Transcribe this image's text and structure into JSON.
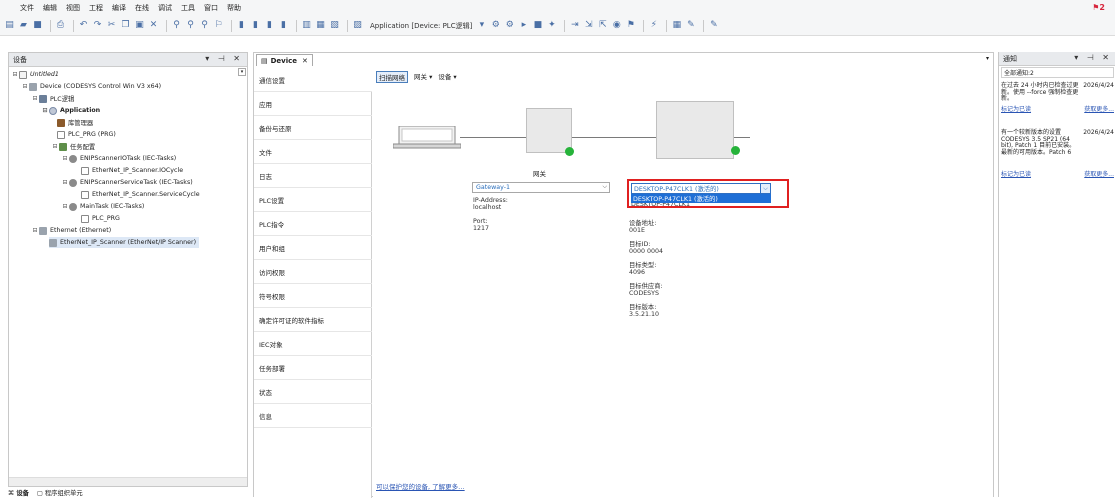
{
  "menu": [
    "文件",
    "编辑",
    "视图",
    "工程",
    "编译",
    "在线",
    "调试",
    "工具",
    "窗口",
    "帮助"
  ],
  "notification_count": "2",
  "toolbar": {
    "application_label": "Application [Device: PLC逻辑]"
  },
  "devices_pane": {
    "title": "设备",
    "controls": "▾ ⊣ ✕",
    "tree": [
      {
        "label": "Untitled1"
      },
      {
        "label": "Device (CODESYS Control Win V3 x64)"
      },
      {
        "label": "PLC逻辑"
      },
      {
        "label": "Application"
      },
      {
        "label": "库管理器"
      },
      {
        "label": "PLC_PRG (PRG)"
      },
      {
        "label": "任务配置"
      },
      {
        "label": "ENIPScannerIOTask (IEC-Tasks)"
      },
      {
        "label": "EtherNet_IP_Scanner.IOCycle"
      },
      {
        "label": "ENIPScannerServiceTask (IEC-Tasks)"
      },
      {
        "label": "EtherNet_IP_Scanner.ServiceCycle"
      },
      {
        "label": "MainTask (IEC-Tasks)"
      },
      {
        "label": "PLC_PRG"
      },
      {
        "label": "Ethernet (Ethernet)"
      },
      {
        "label": "EtherNet_IP_Scanner (EtherNet/IP Scanner)"
      }
    ]
  },
  "bottom_tabs": [
    "设备",
    "程序组织单元"
  ],
  "editor": {
    "tab_label": "Device",
    "nav": [
      "通信设置",
      "应用",
      "备份与还原",
      "文件",
      "日志",
      "PLC设置",
      "PLC指令",
      "用户和组",
      "访问权限",
      "符号权限",
      "确定许可证的软件指标",
      "IEC对象",
      "任务部署",
      "状态",
      "信息"
    ],
    "scan_tabs": [
      "扫描网络",
      "网关 ▾",
      "设备 ▾"
    ],
    "gateway": {
      "label": "网关",
      "selected": "Gateway-1",
      "ip_label": "IP-Address:",
      "ip_value": "localhost",
      "port_label": "Port:",
      "port_value": "1217"
    },
    "device": {
      "selected": "DESKTOP-P47CLK1 (激活的)",
      "option": "DESKTOP-P47CLK1 (激活的)",
      "name_partial": "DESKTOP-P47CLK1",
      "fields": [
        {
          "label": "设备地址:",
          "value": "001E"
        },
        {
          "label": "目标ID:",
          "value": "0000 0004"
        },
        {
          "label": "目标类型:",
          "value": "4096"
        },
        {
          "label": "目标供应商:",
          "value": "CODESYS"
        },
        {
          "label": "目标版本:",
          "value": "3.5.21.10"
        }
      ]
    },
    "bottom_link": "可以保护您的设备, 了解更多…"
  },
  "notifications_pane": {
    "title": "通知",
    "controls": "▾ ⊣ ✕",
    "all_label": "全部通知:2",
    "items": [
      {
        "body": "在过去 24 小时内已检查过更新。使用 --force 强制检查更新。",
        "date": "2026/4/24",
        "mark_read": "标记为已读",
        "more": "获取更多..."
      },
      {
        "body": "有一个较新版本的设置 CODESYS 3.5 SP21 (64 bit), Patch 1 目前已安装。最新的可用版本。Patch 6",
        "date": "2026/4/24",
        "mark_read": "标记为已读",
        "more": "获取更多..."
      }
    ]
  },
  "colors": {
    "accent": "#1f6fd6",
    "highlight_border": "#e02020",
    "online": "#26b33a"
  }
}
